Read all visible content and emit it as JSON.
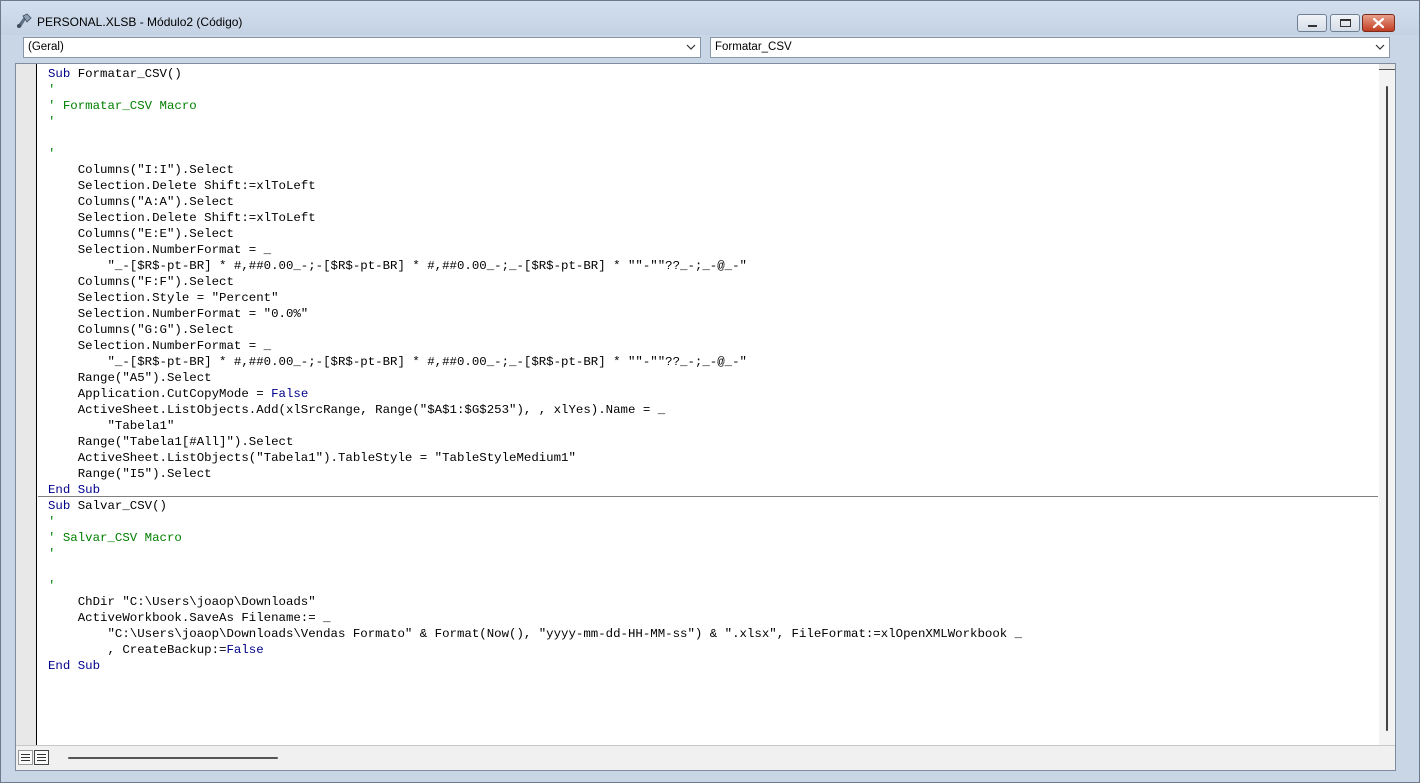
{
  "window": {
    "title": "PERSONAL.XLSB - Módulo2 (Código)",
    "controls": {
      "minimize": "minimize",
      "maximize": "maximize",
      "close": "close"
    }
  },
  "object_combo": {
    "value": "(Geral)"
  },
  "procedure_combo": {
    "value": "Formatar_CSV"
  },
  "code": {
    "lines": [
      {
        "t": "kw",
        "text": "Sub",
        "rest": " Formatar_CSV()"
      },
      {
        "t": "cm",
        "text": "'"
      },
      {
        "t": "cm",
        "text": "' Formatar_CSV Macro"
      },
      {
        "t": "cm",
        "text": "'"
      },
      {
        "t": "plain",
        "text": ""
      },
      {
        "t": "cm",
        "text": "'"
      },
      {
        "t": "plain",
        "text": "    Columns(\"I:I\").Select"
      },
      {
        "t": "plain",
        "text": "    Selection.Delete Shift:=xlToLeft"
      },
      {
        "t": "plain",
        "text": "    Columns(\"A:A\").Select"
      },
      {
        "t": "plain",
        "text": "    Selection.Delete Shift:=xlToLeft"
      },
      {
        "t": "plain",
        "text": "    Columns(\"E:E\").Select"
      },
      {
        "t": "plain",
        "text": "    Selection.NumberFormat = _"
      },
      {
        "t": "plain",
        "text": "        \"_-[$R$-pt-BR] * #,##0.00_-;-[$R$-pt-BR] * #,##0.00_-;_-[$R$-pt-BR] * \"\"-\"\"??_-;_-@_-\""
      },
      {
        "t": "plain",
        "text": "    Columns(\"F:F\").Select"
      },
      {
        "t": "plain",
        "text": "    Selection.Style = \"Percent\""
      },
      {
        "t": "plain",
        "text": "    Selection.NumberFormat = \"0.0%\""
      },
      {
        "t": "plain",
        "text": "    Columns(\"G:G\").Select"
      },
      {
        "t": "plain",
        "text": "    Selection.NumberFormat = _"
      },
      {
        "t": "plain",
        "text": "        \"_-[$R$-pt-BR] * #,##0.00_-;-[$R$-pt-BR] * #,##0.00_-;_-[$R$-pt-BR] * \"\"-\"\"??_-;_-@_-\""
      },
      {
        "t": "plain",
        "text": "    Range(\"A5\").Select"
      },
      {
        "t": "mixed",
        "text": "    Application.CutCopyMode = ",
        "kw": "False"
      },
      {
        "t": "plain",
        "text": "    ActiveSheet.ListObjects.Add(xlSrcRange, Range(\"$A$1:$G$253\"), , xlYes).Name = _"
      },
      {
        "t": "plain",
        "text": "        \"Tabela1\""
      },
      {
        "t": "plain",
        "text": "    Range(\"Tabela1[#All]\").Select"
      },
      {
        "t": "plain",
        "text": "    ActiveSheet.ListObjects(\"Tabela1\").TableStyle = \"TableStyleMedium1\""
      },
      {
        "t": "plain",
        "text": "    Range(\"I5\").Select"
      },
      {
        "t": "kw",
        "text": "End Sub",
        "rest": ""
      },
      {
        "t": "kw",
        "text": "Sub",
        "rest": " Salvar_CSV()"
      },
      {
        "t": "cm",
        "text": "'"
      },
      {
        "t": "cm",
        "text": "' Salvar_CSV Macro"
      },
      {
        "t": "cm",
        "text": "'"
      },
      {
        "t": "plain",
        "text": ""
      },
      {
        "t": "cm",
        "text": "'"
      },
      {
        "t": "plain",
        "text": "    ChDir \"C:\\Users\\joaop\\Downloads\""
      },
      {
        "t": "plain",
        "text": "    ActiveWorkbook.SaveAs Filename:= _"
      },
      {
        "t": "plain",
        "text": "        \"C:\\Users\\joaop\\Downloads\\Vendas Formato\" & Format(Now(), \"yyyy-mm-dd-HH-MM-ss\") & \".xlsx\", FileFormat:=xlOpenXMLWorkbook _"
      },
      {
        "t": "mixed",
        "text": "        , CreateBackup:=",
        "kw": "False"
      },
      {
        "t": "kw",
        "text": "End Sub",
        "rest": ""
      }
    ]
  },
  "colors": {
    "keyword": "#00008b",
    "comment": "#008000",
    "text": "#000000"
  }
}
